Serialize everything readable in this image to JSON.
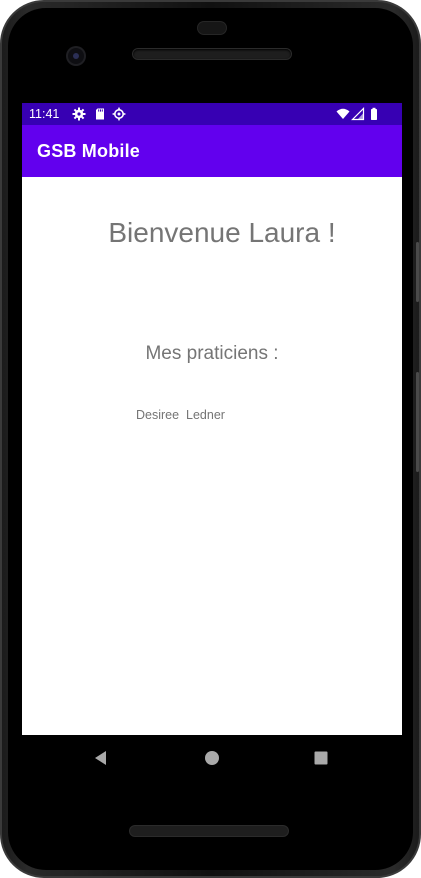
{
  "status_bar": {
    "time": "11:41",
    "left_icons": [
      "settings-icon",
      "sd-card-icon",
      "settings-gear-icon"
    ],
    "right_icons": [
      "wifi-icon",
      "signal-icon",
      "battery-icon"
    ],
    "background": "#3700b3"
  },
  "app_bar": {
    "title": "GSB Mobile",
    "background": "#6200ee"
  },
  "main": {
    "welcome": "Bienvenue Laura !",
    "section_title": "Mes praticiens :",
    "practitioners": [
      {
        "name": "Desiree  Ledner"
      }
    ]
  },
  "nav_bar": {
    "buttons": [
      "back-icon",
      "home-icon",
      "recents-icon"
    ]
  }
}
